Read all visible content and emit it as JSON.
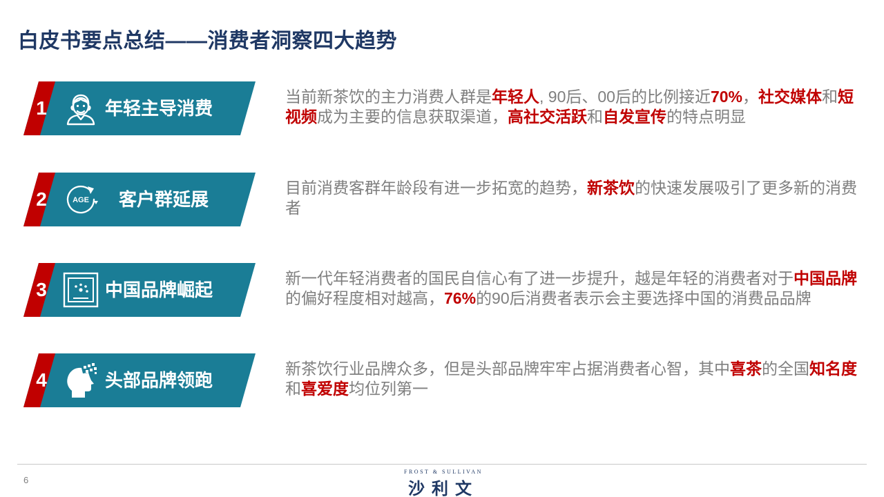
{
  "title": "白皮书要点总结——消费者洞察四大趋势",
  "trends": [
    {
      "number": "1",
      "label": "年轻主导消费",
      "icon": "young-person-icon",
      "description": [
        {
          "text": "当前新茶饮的主力消费人群是"
        },
        {
          "text": "年轻人",
          "highlight": true
        },
        {
          "text": ", 90后、00后的比例接近"
        },
        {
          "text": "70%",
          "highlight": true
        },
        {
          "text": "，"
        },
        {
          "text": "社交媒体",
          "highlight": true
        },
        {
          "text": "和"
        },
        {
          "text": "短视频",
          "highlight": true
        },
        {
          "text": "成为主要的信息获取渠道，"
        },
        {
          "text": "高社交活跃",
          "highlight": true
        },
        {
          "text": "和"
        },
        {
          "text": "自发宣传",
          "highlight": true
        },
        {
          "text": "的特点明显"
        }
      ]
    },
    {
      "number": "2",
      "label": "客户群延展",
      "icon": "age-cycle-icon",
      "icon_text": "AGE",
      "description": [
        {
          "text": "目前消费客群年龄段有进一步拓宽的趋势，"
        },
        {
          "text": "新茶饮",
          "highlight": true
        },
        {
          "text": "的快速发展吸引了更多新的消费者"
        }
      ]
    },
    {
      "number": "3",
      "label": "中国品牌崛起",
      "icon": "china-flag-icon",
      "description": [
        {
          "text": "新一代年轻消费者的国民自信心有了进一步提升，越是年轻的消费者对于"
        },
        {
          "text": "中国品牌",
          "highlight": true
        },
        {
          "text": "的偏好程度相对越高，"
        },
        {
          "text": "76%",
          "highlight": true
        },
        {
          "text": "的90后消费者表示会主要选择中国的消费品品牌"
        }
      ]
    },
    {
      "number": "4",
      "label": "头部品牌领跑",
      "icon": "head-mind-icon",
      "description": [
        {
          "text": "新茶饮行业品牌众多，但是头部品牌牢牢占据消费者心智，其中"
        },
        {
          "text": "喜茶",
          "highlight": true
        },
        {
          "text": "的全国"
        },
        {
          "text": "知名度",
          "highlight": true
        },
        {
          "text": "和"
        },
        {
          "text": "喜爱度",
          "highlight": true
        },
        {
          "text": "均位列第一"
        }
      ]
    }
  ],
  "footer": {
    "page_number": "6",
    "logo_en": "FROST & SULLIVAN",
    "logo_cn": "沙利文"
  },
  "colors": {
    "title": "#1f3864",
    "banner": "#1a7d96",
    "accent": "#c00000",
    "body_text": "#7f7f7f"
  }
}
